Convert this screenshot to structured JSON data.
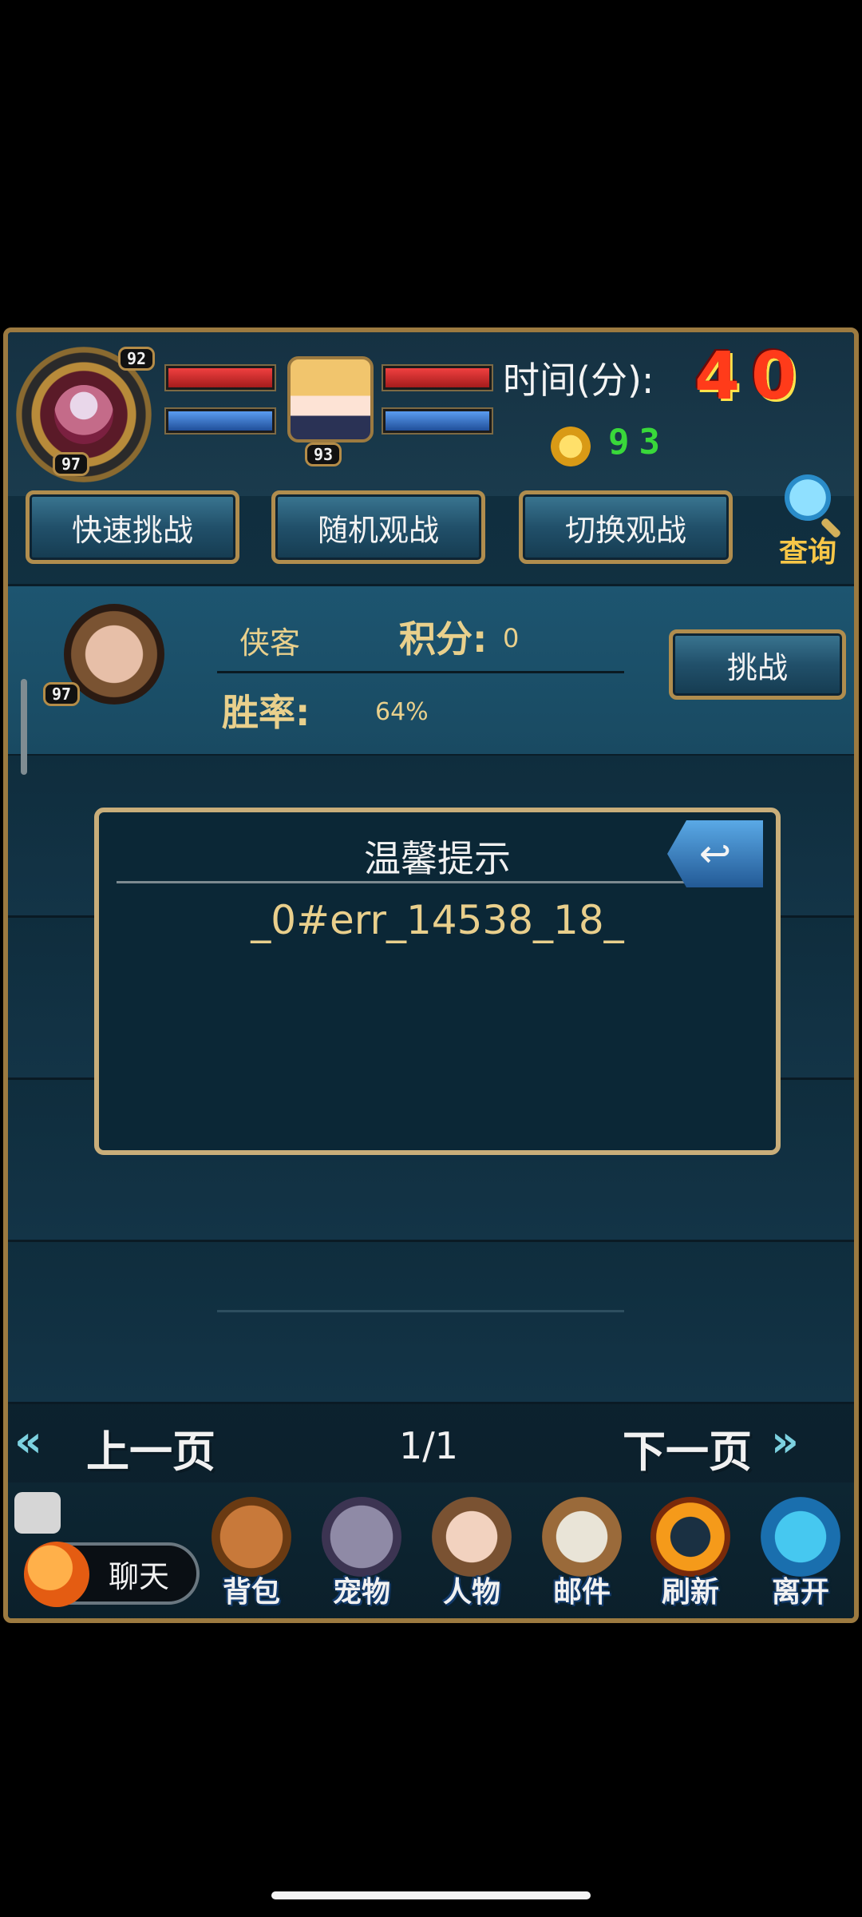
{
  "hud": {
    "player_level_top": "92",
    "player_level_bottom": "97",
    "opponent_level": "93",
    "time_label": "时间(分):",
    "time_value": "40",
    "coins": "93"
  },
  "actions": {
    "quick_challenge": "快速挑战",
    "random_watch": "随机观战",
    "switch_watch": "切换观战",
    "search": "查询"
  },
  "player": {
    "level": "97",
    "name": "侠客",
    "score_label": "积分:",
    "score_value": "0",
    "win_label": "胜率:",
    "win_value": "64%",
    "challenge_button": "挑战"
  },
  "dialog": {
    "title": "温馨提示",
    "message": "_0#err_14538_18_"
  },
  "pager": {
    "prev": "上一页",
    "page": "1/1",
    "next": "下一页"
  },
  "dock": {
    "chat": "聊天",
    "items": [
      {
        "label": "背包",
        "icon": "backpack-icon"
      },
      {
        "label": "宠物",
        "icon": "pet-icon"
      },
      {
        "label": "人物",
        "icon": "character-icon"
      },
      {
        "label": "邮件",
        "icon": "mail-icon"
      },
      {
        "label": "刷新",
        "icon": "refresh-icon"
      },
      {
        "label": "离开",
        "icon": "exit-icon"
      }
    ]
  },
  "colors": {
    "gold_border": "#b08d4e",
    "button_blue": "#21506a",
    "text_gold": "#e9d08c",
    "time_red": "#ff3b1a",
    "coin_green": "#39d83a"
  }
}
